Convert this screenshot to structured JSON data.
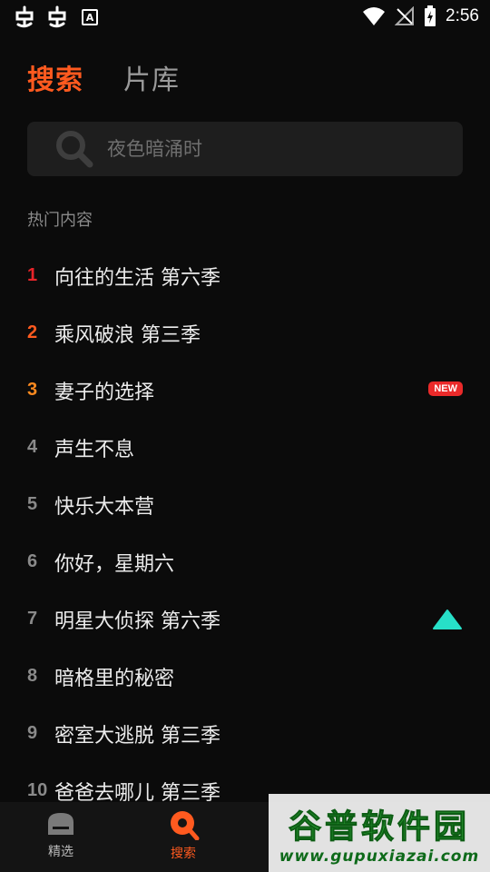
{
  "status_bar": {
    "time": "2:56",
    "notification_letter": "A"
  },
  "tabs": [
    {
      "label": "搜索",
      "active": true
    },
    {
      "label": "片库",
      "active": false
    }
  ],
  "search": {
    "placeholder": "夜色暗涌时"
  },
  "section_title": "热门内容",
  "hot_list": [
    {
      "rank": "1",
      "title": "向往的生活 第六季"
    },
    {
      "rank": "2",
      "title": "乘风破浪 第三季"
    },
    {
      "rank": "3",
      "title": "妻子的选择",
      "badge": "NEW"
    },
    {
      "rank": "4",
      "title": "声生不息"
    },
    {
      "rank": "5",
      "title": "快乐大本营"
    },
    {
      "rank": "6",
      "title": "你好，星期六"
    },
    {
      "rank": "7",
      "title": "明星大侦探 第六季",
      "trend": "up-icon"
    },
    {
      "rank": "8",
      "title": "暗格里的秘密"
    },
    {
      "rank": "9",
      "title": "密室大逃脱 第三季"
    },
    {
      "rank": "10",
      "title": "爸爸去哪儿 第三季"
    }
  ],
  "bottom_nav": [
    {
      "label": "精选",
      "icon": "home-icon",
      "active": false
    },
    {
      "label": "搜索",
      "icon": "search-icon",
      "active": true
    }
  ],
  "watermark": {
    "title": "谷普软件园",
    "url": "www.gupuxiazai.com"
  },
  "colors": {
    "accent": "#ff5a1f",
    "rank1": "#e8242a",
    "rank2": "#ff5a1f",
    "rank3": "#ff8a1f",
    "trend_up": "#27e0c8",
    "background": "#0b0b0b"
  }
}
